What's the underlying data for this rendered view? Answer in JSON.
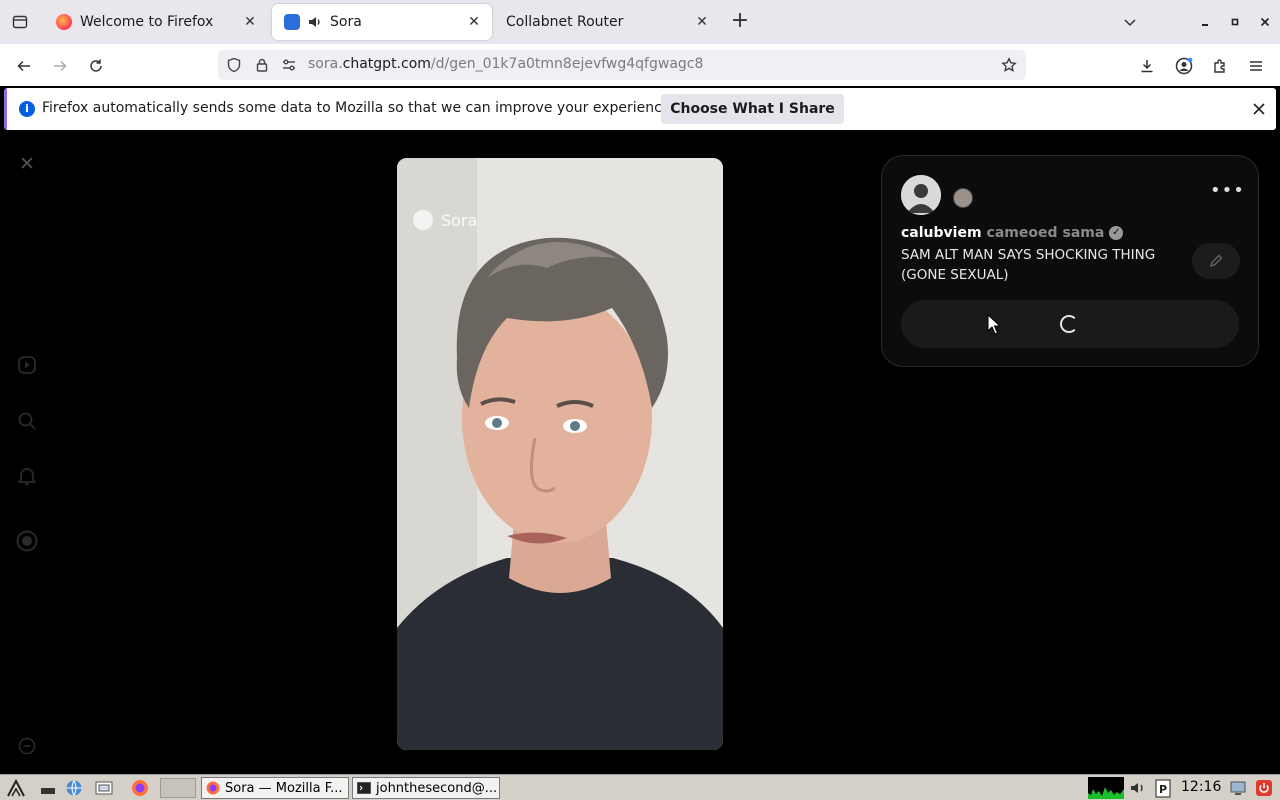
{
  "browser": {
    "tabs": [
      {
        "label": "Welcome to Firefox",
        "active": false
      },
      {
        "label": "Sora",
        "active": true,
        "playing_audio": true
      },
      {
        "label": "Collabnet Router",
        "active": false
      }
    ],
    "url": {
      "prefix": "sora.",
      "host": "chatgpt.com",
      "path": "/d/gen_01k7a0tmn8ejevfwg4qfgwagc8"
    }
  },
  "notification": {
    "text": "Firefox automatically sends some data to Mozilla so that we can improve your experience.",
    "button_label": "Choose What I Share"
  },
  "video": {
    "watermark": "Sora"
  },
  "post": {
    "username": "calubviem",
    "verb": "cameoed",
    "cameo_user": "sama",
    "caption": "SAM ALT MAN SAYS SHOCKING THING (GONE SEXUAL)"
  },
  "taskbar": {
    "tasks": [
      {
        "label": "Sora — Mozilla F..."
      },
      {
        "label": "johnthesecond@..."
      }
    ],
    "clock": "12:16"
  },
  "colors": {
    "accent": "#8f6ce6",
    "info_blue": "#0060df",
    "page_background": "#000000"
  }
}
